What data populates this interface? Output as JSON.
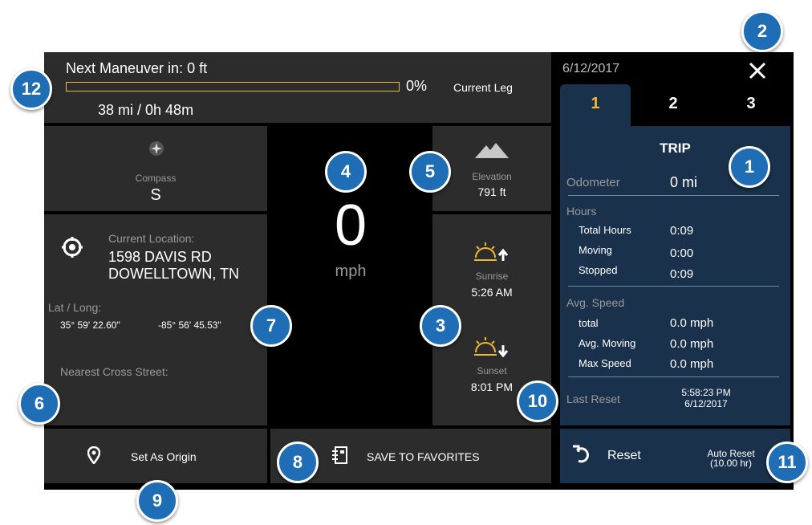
{
  "header": {
    "maneuver_label": "Next Maneuver in: 0 ft",
    "progress_percent_text": "0%",
    "progress_value": 0,
    "current_leg_label": "Current Leg",
    "distance_time": "38 mi / 0h 48m"
  },
  "compass": {
    "title": "Compass",
    "value": "S",
    "icon": "compass-icon"
  },
  "speed": {
    "value": "0",
    "unit": "mph"
  },
  "elevation": {
    "title": "Elevation",
    "value": "791 ft",
    "icon": "mountain-icon"
  },
  "location": {
    "title": "Current Location:",
    "line1": "1598 DAVIS RD",
    "line2": "DOWELLTOWN, TN",
    "latlong_label": "Lat / Long:",
    "lat": "35° 59' 22.60\"",
    "long": "-85° 56' 45.53\"",
    "cross_street_label": "Nearest Cross Street:",
    "icon": "crosshair-icon"
  },
  "sun": {
    "sunrise_label": "Sunrise",
    "sunrise_time": "5:26 AM",
    "sunset_label": "Sunset",
    "sunset_time": "8:01 PM",
    "accent": "#f2b632"
  },
  "bottom": {
    "origin_label": "Set As Origin",
    "favorites_label": "SAVE TO FAVORITES",
    "reset_label": "Reset",
    "auto_reset_line1": "Auto Reset",
    "auto_reset_line2": "(10.00 hr)"
  },
  "trip": {
    "date": "6/12/2017",
    "tabs": [
      "1",
      "2",
      "3"
    ],
    "active_tab": "1",
    "title": "TRIP",
    "odometer_label": "Odometer",
    "odometer_value": "0 mi",
    "hours_label": "Hours",
    "total_hours_label": "Total Hours",
    "total_hours_value": "0:09",
    "moving_label": "Moving",
    "moving_value": "0:00",
    "stopped_label": "Stopped",
    "stopped_value": "0:09",
    "avg_speed_label": "Avg. Speed",
    "total_label": "total",
    "total_value": "0.0 mph",
    "avg_moving_label": "Avg. Moving",
    "avg_moving_value": "0.0 mph",
    "max_speed_label": "Max Speed",
    "max_speed_value": "0.0 mph",
    "last_reset_label": "Last Reset",
    "last_reset_time": "5:58:23 PM",
    "last_reset_date": "6/12/2017"
  },
  "callouts": [
    "1",
    "2",
    "3",
    "4",
    "5",
    "6",
    "7",
    "8",
    "9",
    "10",
    "11",
    "12"
  ],
  "colors": {
    "panel": "#2c2c2c",
    "trip_bg": "#19314a",
    "tab_active": "#f2b632",
    "callout": "#1e6db5"
  }
}
